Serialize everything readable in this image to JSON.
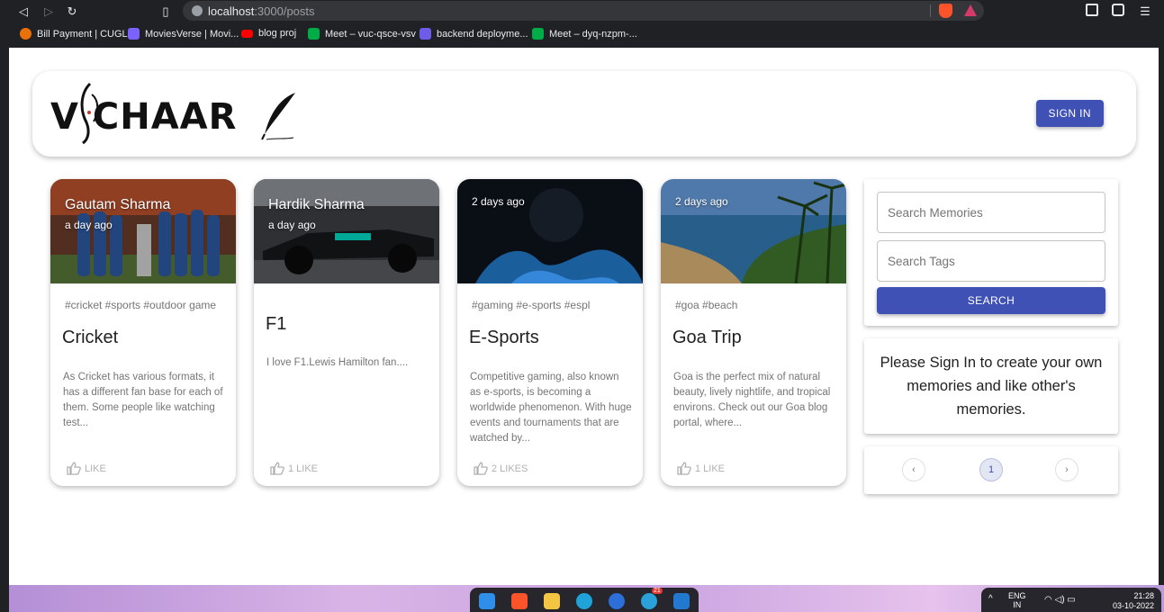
{
  "browser": {
    "url_host": "localhost",
    "url_path": ":3000/posts",
    "bookmarks": [
      {
        "label": "Bill Payment | CUGL",
        "color": "#e8710a"
      },
      {
        "label": "MoviesVerse | Movi...",
        "color": "#7b61ff"
      },
      {
        "label": "blog proj",
        "color": "#ff0000"
      },
      {
        "label": "Meet – vuc-qsce-vsv",
        "color": "#00ac47"
      },
      {
        "label": "backend deployme...",
        "color": "#6c5ce7"
      },
      {
        "label": "Meet – dyq-nzpm-...",
        "color": "#00ac47"
      }
    ]
  },
  "header": {
    "logo_text": "V CHAAR",
    "signin_label": "SIGN IN"
  },
  "posts": [
    {
      "author": "Gautam Sharma",
      "time": "a day ago",
      "tags": "#cricket #sports #outdoor game",
      "title": "Cricket",
      "message": "As Cricket has various formats, it has a different fan base for each of them. Some people like watching test...",
      "likes": "LIKE"
    },
    {
      "author": "Hardik Sharma",
      "time": "a day ago",
      "tags": "",
      "title": "F1",
      "message": "I love F1.Lewis Hamilton fan....",
      "likes": "1 LIKE"
    },
    {
      "author": "",
      "time": "2 days ago",
      "tags": "#gaming #e-sports #espl",
      "title": "E-Sports",
      "message": "Competitive gaming, also known as e-sports, is becoming a worldwide phenomenon. With huge events and tournaments that are watched by...",
      "likes": "2 LIKES"
    },
    {
      "author": "",
      "time": "2 days ago",
      "tags": "#goa #beach",
      "title": "Goa Trip",
      "message": "Goa is the perfect mix of natural beauty, lively nightlife, and tropical environs. Check out our Goa blog portal, where...",
      "likes": "1 LIKE"
    }
  ],
  "search": {
    "memories_placeholder": "Search Memories",
    "tags_placeholder": "Search Tags",
    "button_label": "SEARCH"
  },
  "notice": "Please Sign In to create your own memories and like other's memories.",
  "pagination": {
    "current": "1"
  },
  "taskbar": {
    "lang_line1": "ENG",
    "lang_line2": "IN",
    "time": "21:28",
    "date": "03-10-2022",
    "telegram_badge": "21"
  },
  "colors": {
    "primary": "#3f51b5"
  }
}
